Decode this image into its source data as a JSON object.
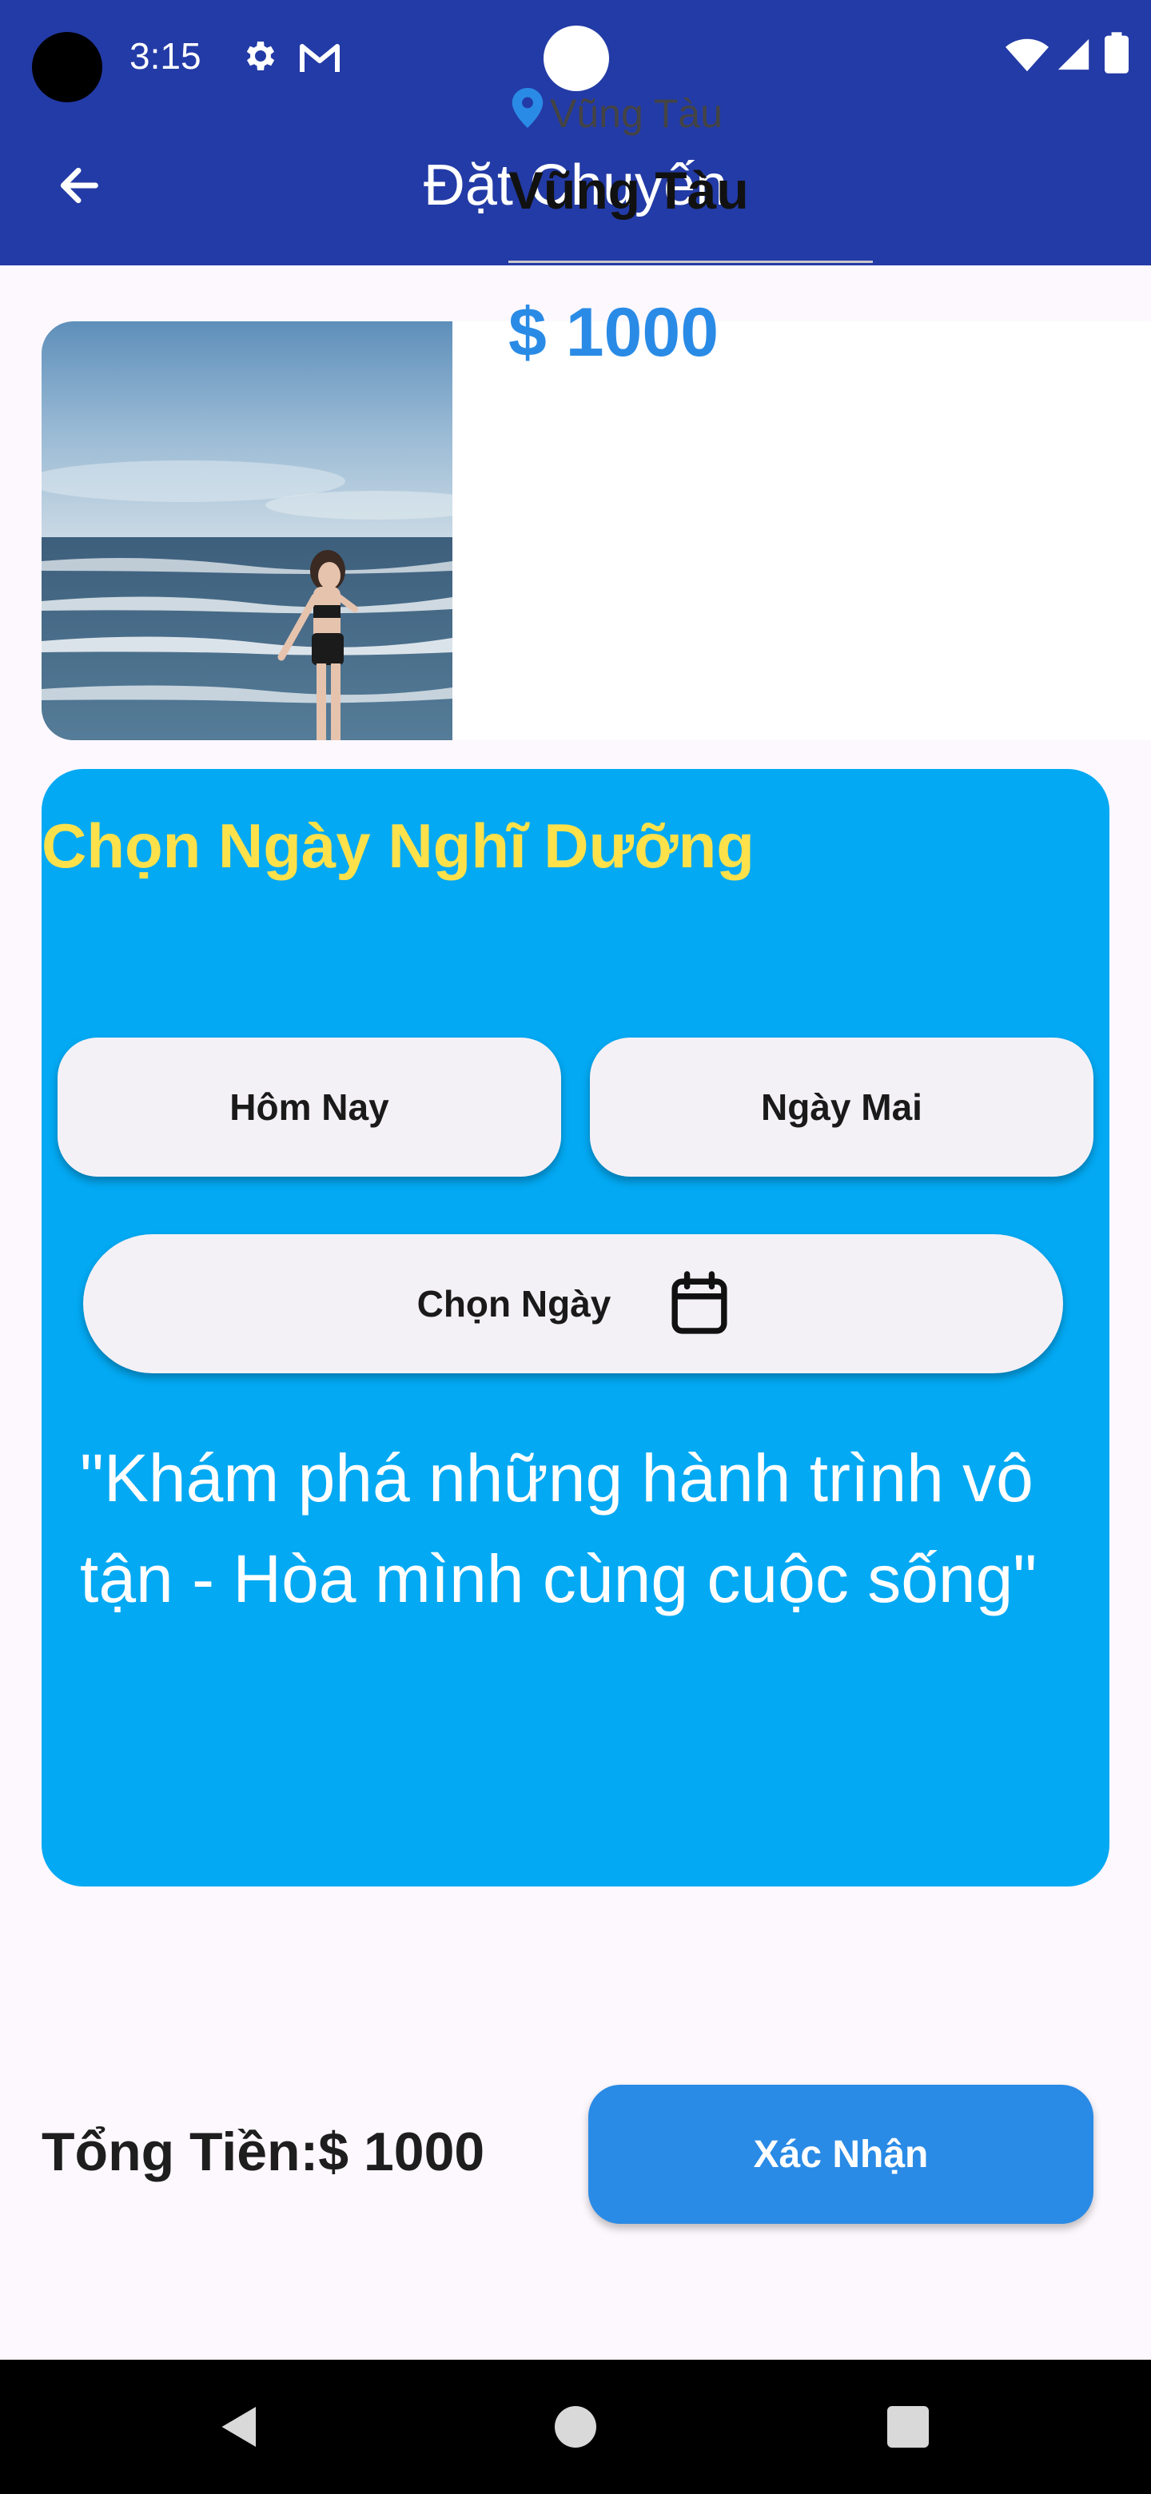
{
  "status_bar": {
    "time": "3:15"
  },
  "app_bar": {
    "title": "Đặt Chuyến"
  },
  "trip": {
    "location_label": "Vũng Tàu",
    "name": "Vũng Tàu",
    "price": "$ 1000"
  },
  "date_panel": {
    "title": "Chọn Ngày Nghĩ Dưỡng",
    "today_label": "Hôm Nay",
    "tomorrow_label": "Ngày Mai",
    "pick_label": "Chọn Ngày",
    "quote": "\"Khám phá những hành trình vô tận - Hòa mình cùng cuộc sống\""
  },
  "footer": {
    "total": "Tổng Tiền:$ 1000",
    "confirm_label": "Xác Nhận"
  },
  "colors": {
    "app_bar": "#233ba6",
    "panel": "#03a9f3",
    "accent": "#2a8be6",
    "panel_title": "#fde14b"
  }
}
